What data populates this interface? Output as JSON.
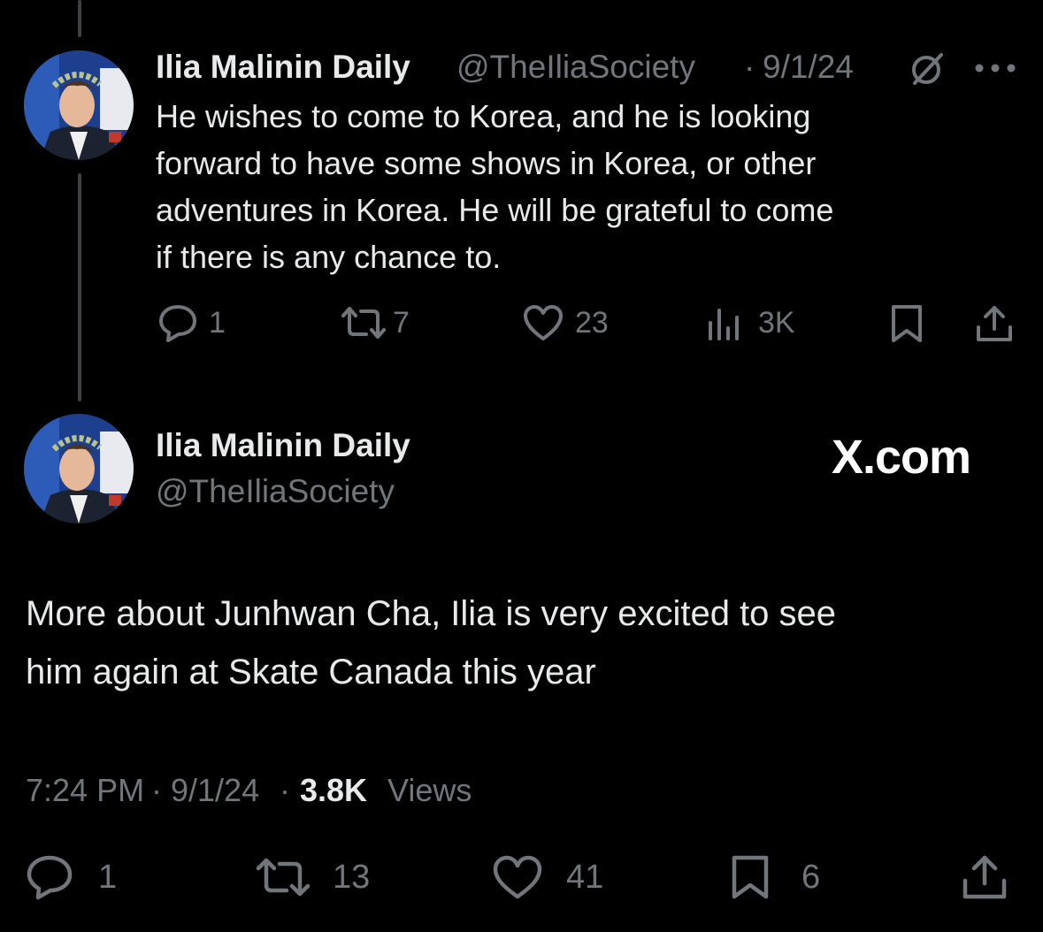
{
  "reply_tweet": {
    "author_name": "Ilia Malinin Daily",
    "handle": "@TheIliaSociety",
    "separator": "·",
    "date": "9/1/24",
    "text": "He wishes to come to Korea, and he is looking forward to have some shows in Korea, or other adventures in Korea. He will be grateful to come if there is any chance to.",
    "text_lines": [
      "He wishes to come to Korea, and he is looking",
      "forward to have some shows in Korea, or other",
      "adventures in Korea. He will be grateful to come",
      "if there is any chance to."
    ],
    "replies": "1",
    "reposts": "7",
    "likes": "23",
    "views": "3K"
  },
  "main_tweet": {
    "author_name": "Ilia Malinin Daily",
    "handle": "@TheIliaSociety",
    "watermark": "X.com",
    "text": "More about Junhwan Cha, Ilia is very excited to see him again at Skate Canada this year",
    "text_lines": [
      "More about Junhwan Cha, Ilia is very excited to see",
      "him again at Skate Canada this year"
    ],
    "time": "7:24 PM",
    "separator": "·",
    "date": "9/1/24",
    "views_count": "3.8K",
    "views_label": "Views",
    "replies": "1",
    "reposts": "13",
    "likes": "41",
    "bookmarks": "6"
  },
  "icons": [
    "avatar-icon",
    "grok-icon",
    "more-icon",
    "reply-icon",
    "repost-icon",
    "like-icon",
    "views-icon",
    "bookmark-icon",
    "share-icon"
  ],
  "colors": {
    "background": "#000000",
    "text": "#e7e9ea",
    "muted": "#71767b",
    "thread_line": "#3e4144"
  }
}
